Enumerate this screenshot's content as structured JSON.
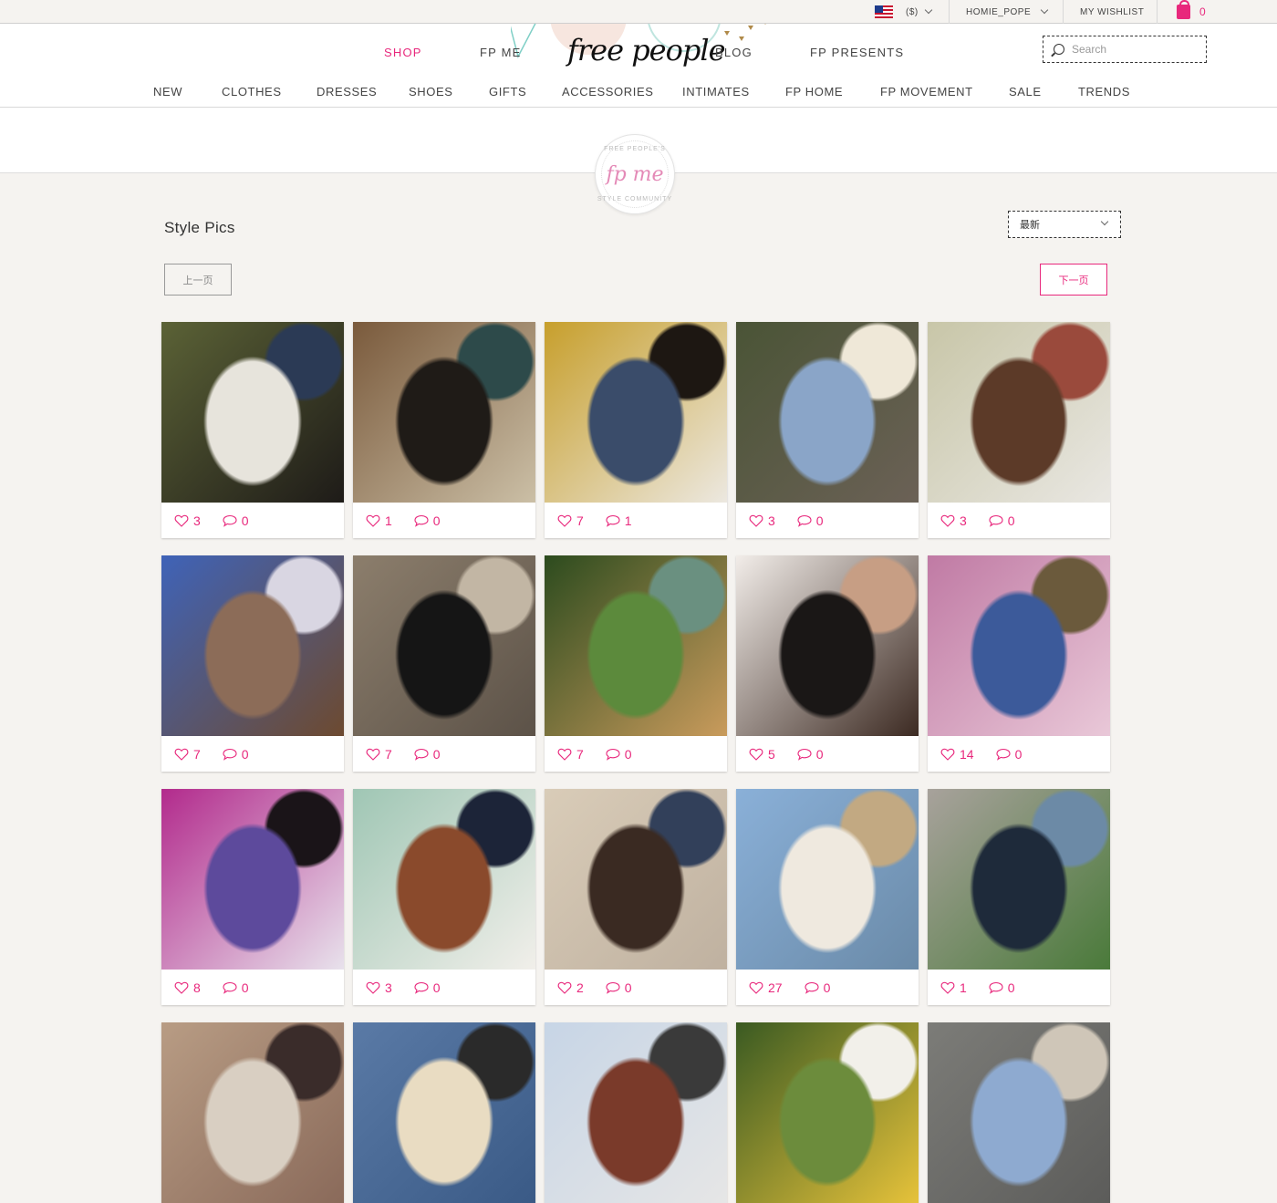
{
  "utility": {
    "currency": "($)",
    "username": "HOMIE_POPE",
    "wishlist": "MY WISHLIST",
    "cart_count": "0"
  },
  "header": {
    "logo": "free people",
    "nav_top": [
      "SHOP",
      "FP ME",
      "BLOG",
      "FP PRESENTS"
    ],
    "search_placeholder": "Search",
    "categories": [
      "NEW",
      "CLOTHES",
      "DRESSES",
      "SHOES",
      "GIFTS",
      "ACCESSORIES",
      "INTIMATES",
      "FP HOME",
      "FP MOVEMENT",
      "SALE",
      "TRENDS"
    ]
  },
  "badge": {
    "logo": "fp me",
    "top_text": "FREE PEOPLE'S",
    "bottom_text": "STYLE COMMUNITY"
  },
  "page": {
    "title": "Style Pics",
    "sort_value": "最新",
    "prev_label": "上一页",
    "next_label": "下一页"
  },
  "colors": {
    "accent": "#e8287c",
    "background": "#f5f3f0"
  },
  "posts": [
    {
      "likes": "3",
      "comments": "0",
      "palette": [
        "#5b6236",
        "#e7e4dc",
        "#2b3a55",
        "#1e1b18"
      ]
    },
    {
      "likes": "1",
      "comments": "0",
      "palette": [
        "#7a5a3c",
        "#1f1b17",
        "#2d4a4a",
        "#cbbfa6"
      ]
    },
    {
      "likes": "7",
      "comments": "1",
      "palette": [
        "#c79f2c",
        "#3a4c6a",
        "#1d1712",
        "#ece8e0"
      ]
    },
    {
      "likes": "3",
      "comments": "0",
      "palette": [
        "#4a5436",
        "#8aa5c8",
        "#efe8d8",
        "#6b6156"
      ]
    },
    {
      "likes": "3",
      "comments": "0",
      "palette": [
        "#c8c6a8",
        "#5c3a28",
        "#9a4a3c",
        "#e9e7e2"
      ]
    },
    {
      "likes": "7",
      "comments": "0",
      "palette": [
        "#3f63b8",
        "#8c6c58",
        "#d9d6e2",
        "#6d4a30"
      ]
    },
    {
      "likes": "7",
      "comments": "0",
      "palette": [
        "#8c7e6c",
        "#151515",
        "#c2b6a4",
        "#5c5248"
      ]
    },
    {
      "likes": "7",
      "comments": "0",
      "palette": [
        "#2c4b1e",
        "#5c8a3c",
        "#6a9080",
        "#c99b5c"
      ]
    },
    {
      "likes": "5",
      "comments": "0",
      "palette": [
        "#f2ede9",
        "#1a1716",
        "#c79e84",
        "#3c2a22"
      ]
    },
    {
      "likes": "14",
      "comments": "0",
      "palette": [
        "#c07aa4",
        "#3c5a9a",
        "#6b5a3c",
        "#e9c8d8"
      ]
    },
    {
      "likes": "8",
      "comments": "0",
      "palette": [
        "#b22a8c",
        "#5d4a9c",
        "#1a1418",
        "#e8e2ec"
      ]
    },
    {
      "likes": "3",
      "comments": "0",
      "palette": [
        "#9fc6b4",
        "#8a4a2c",
        "#1c2438",
        "#f1efea"
      ]
    },
    {
      "likes": "2",
      "comments": "0",
      "palette": [
        "#d9ccb8",
        "#3a2a22",
        "#32405a",
        "#bfb1a0"
      ]
    },
    {
      "likes": "27",
      "comments": "0",
      "palette": [
        "#8ab0d8",
        "#efe9df",
        "#c2a982",
        "#6a8aa8"
      ]
    },
    {
      "likes": "1",
      "comments": "0",
      "palette": [
        "#a8a29c",
        "#1e2a3a",
        "#6c8aa6",
        "#4a7a3a"
      ]
    },
    {
      "likes": "",
      "comments": "",
      "palette": [
        "#b89c84",
        "#d9cfc2",
        "#3a2c2a",
        "#8a6a5a"
      ]
    },
    {
      "likes": "",
      "comments": "",
      "palette": [
        "#5a7aa6",
        "#e9dcc2",
        "#2a2a2a",
        "#3a5a86"
      ]
    },
    {
      "likes": "",
      "comments": "",
      "palette": [
        "#c7d5e6",
        "#7a3a2a",
        "#3a3a3a",
        "#e6e6e6"
      ]
    },
    {
      "likes": "",
      "comments": "",
      "palette": [
        "#3a5a22",
        "#6c8c3c",
        "#f2f0ea",
        "#e6c23a"
      ]
    },
    {
      "likes": "",
      "comments": "",
      "palette": [
        "#7c7c78",
        "#8eaad0",
        "#cfc6b8",
        "#5c5c5a"
      ]
    }
  ]
}
